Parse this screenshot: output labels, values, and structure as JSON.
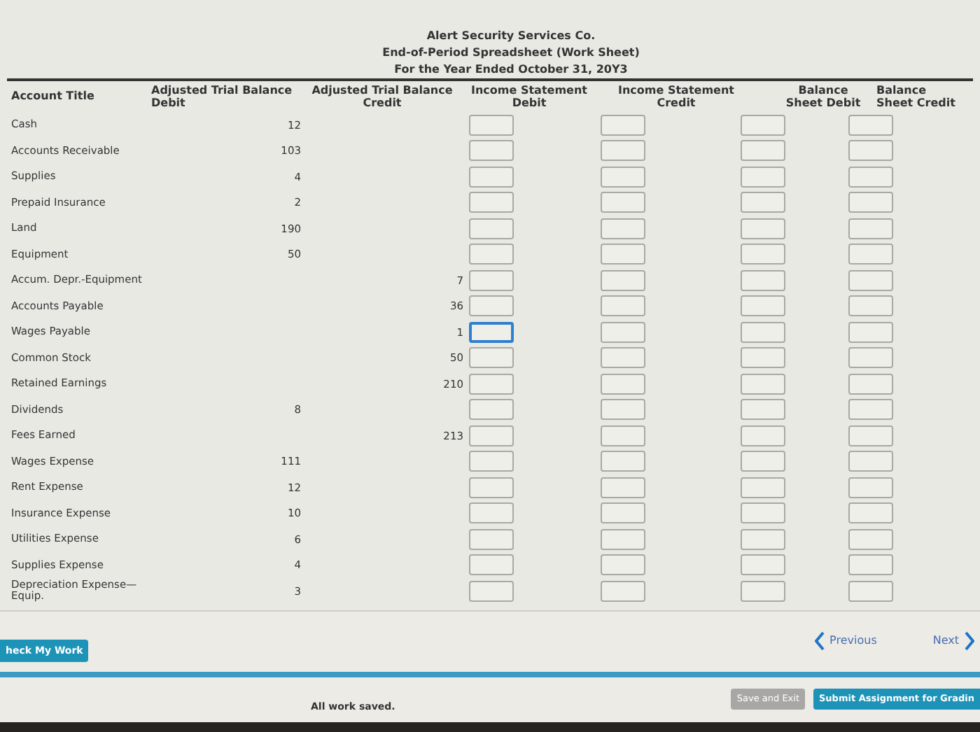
{
  "heading": [
    "Alert Security Services Co.",
    "End-of-Period Spreadsheet (Work Sheet)",
    "For the Year Ended October 31, 20Y3"
  ],
  "columns": [
    {
      "label": "Account Title"
    },
    {
      "label": "Adjusted Trial Balance Debit"
    },
    {
      "label": "Adjusted Trial Balance Credit"
    },
    {
      "label": "Income Statement Debit"
    },
    {
      "label": "Income Statement Credit"
    },
    {
      "label": "Balance Sheet Debit"
    },
    {
      "label": "Balance Sheet Credit"
    }
  ],
  "rows": [
    {
      "account": "Cash",
      "debit": "12",
      "inputs": [
        {
          "focused": false
        },
        {
          "focused": false
        },
        {
          "focused": false
        },
        {
          "focused": false
        }
      ]
    },
    {
      "account": "Accounts Receivable",
      "debit": "103",
      "inputs": [
        {
          "focused": false
        },
        {
          "focused": false
        },
        {
          "focused": false
        },
        {
          "focused": false
        }
      ]
    },
    {
      "account": "Supplies",
      "debit": "4",
      "inputs": [
        {
          "focused": false
        },
        {
          "focused": false
        },
        {
          "focused": false
        },
        {
          "focused": false
        }
      ]
    },
    {
      "account": "Prepaid Insurance",
      "debit": "2",
      "inputs": [
        {
          "focused": false
        },
        {
          "focused": false
        },
        {
          "focused": false
        },
        {
          "focused": false
        }
      ]
    },
    {
      "account": "Land",
      "debit": "190",
      "inputs": [
        {
          "focused": false
        },
        {
          "focused": false
        },
        {
          "focused": false
        },
        {
          "focused": false
        }
      ]
    },
    {
      "account": "Equipment",
      "debit": "50",
      "inputs": [
        {
          "focused": false
        },
        {
          "focused": false
        },
        {
          "focused": false
        },
        {
          "focused": false
        }
      ]
    },
    {
      "account": "Accum. Depr.-Equipment",
      "credit": "7",
      "inputs": [
        {
          "focused": false
        },
        {
          "focused": false
        },
        {
          "focused": false
        },
        {
          "focused": false
        }
      ]
    },
    {
      "account": "Accounts Payable",
      "credit": "36",
      "inputs": [
        {
          "focused": false
        },
        {
          "focused": false
        },
        {
          "focused": false
        },
        {
          "focused": false
        }
      ]
    },
    {
      "account": "Wages Payable",
      "credit": "1",
      "inputs": [
        {
          "focused": true
        },
        {
          "focused": false
        },
        {
          "focused": false
        },
        {
          "focused": false
        }
      ]
    },
    {
      "account": "Common Stock",
      "credit": "50",
      "inputs": [
        {
          "focused": false
        },
        {
          "focused": false
        },
        {
          "focused": false
        },
        {
          "focused": false
        }
      ]
    },
    {
      "account": "Retained Earnings",
      "credit": "210",
      "inputs": [
        {
          "focused": false
        },
        {
          "focused": false
        },
        {
          "focused": false
        },
        {
          "focused": false
        }
      ]
    },
    {
      "account": "Dividends",
      "debit": "8",
      "inputs": [
        {
          "focused": false
        },
        {
          "focused": false
        },
        {
          "focused": false
        },
        {
          "focused": false
        }
      ]
    },
    {
      "account": "Fees Earned",
      "credit": "213",
      "inputs": [
        {
          "focused": false
        },
        {
          "focused": false
        },
        {
          "focused": false
        },
        {
          "focused": false
        }
      ]
    },
    {
      "account": "Wages Expense",
      "debit": "111",
      "inputs": [
        {
          "focused": false
        },
        {
          "focused": false
        },
        {
          "focused": false
        },
        {
          "focused": false
        }
      ]
    },
    {
      "account": "Rent Expense",
      "debit": "12",
      "inputs": [
        {
          "focused": false
        },
        {
          "focused": false
        },
        {
          "focused": false
        },
        {
          "focused": false
        }
      ]
    },
    {
      "account": "Insurance Expense",
      "debit": "10",
      "inputs": [
        {
          "focused": false
        },
        {
          "focused": false
        },
        {
          "focused": false
        },
        {
          "focused": false
        }
      ]
    },
    {
      "account": "Utilities Expense",
      "debit": "6",
      "inputs": [
        {
          "focused": false
        },
        {
          "focused": false
        },
        {
          "focused": false
        },
        {
          "focused": false
        }
      ]
    },
    {
      "account": "Supplies Expense",
      "debit": "4",
      "inputs": [
        {
          "focused": false
        },
        {
          "focused": false
        },
        {
          "focused": false
        },
        {
          "focused": false
        }
      ]
    },
    {
      "account": "Depreciation Expense—Equip.",
      "debit": "3",
      "inputs": [
        {
          "focused": false
        },
        {
          "focused": false
        },
        {
          "focused": false
        },
        {
          "focused": false
        }
      ]
    }
  ],
  "check_button": "heck My Work",
  "previous": "Previous",
  "next": "Next",
  "status": "All work saved.",
  "save_exit": "Save and Exit",
  "submit": "Submit Assignment for Gradin"
}
